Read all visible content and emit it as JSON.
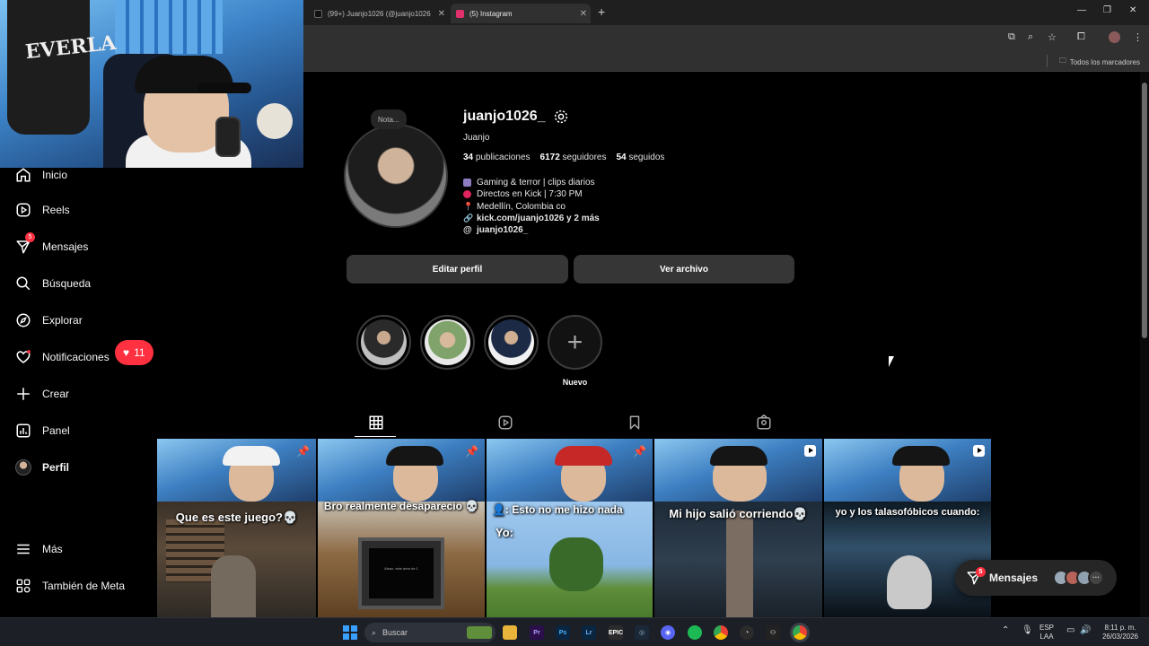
{
  "browser": {
    "tabs": [
      {
        "title": "(99+) Juanjo1026 (@juanjo1026",
        "favicon_color": "#111111"
      },
      {
        "title": "(5) Instagram",
        "favicon_color": "#e1306c"
      }
    ],
    "new_tab_icon": "plus-icon",
    "bookmarks_label": "Todos los marcadores"
  },
  "sidebar": {
    "items": [
      {
        "label": "Inicio",
        "icon": "home-icon"
      },
      {
        "label": "Reels",
        "icon": "reels-icon"
      },
      {
        "label": "Mensajes",
        "icon": "messenger-icon",
        "badge": "5"
      },
      {
        "label": "Búsqueda",
        "icon": "search-icon"
      },
      {
        "label": "Explorar",
        "icon": "compass-icon"
      },
      {
        "label": "Notificaciones",
        "icon": "heart-icon"
      },
      {
        "label": "Crear",
        "icon": "plus-icon"
      },
      {
        "label": "Panel",
        "icon": "chart-icon"
      },
      {
        "label": "Perfil",
        "icon": "avatar"
      }
    ],
    "notifications_count": "11",
    "more_label": "Más",
    "meta_label": "También de Meta"
  },
  "profile": {
    "note_label": "Nota...",
    "username": "juanjo1026_",
    "full_name": "Juanjo",
    "posts_count": "34",
    "posts_label": "publicaciones",
    "followers_count": "6172",
    "followers_label": "seguidores",
    "following_count": "54",
    "following_label": "seguidos",
    "bio": [
      {
        "text": "Gaming & terror | clips diarios",
        "icon": "gamepad-icon",
        "color": "#8e7cc3"
      },
      {
        "text": "Directos en Kick | 7:30 PM",
        "icon": "red-circle-icon",
        "color": "#e0245e"
      },
      {
        "text": "Medellín, Colombia co",
        "icon": "pin-icon",
        "color": "#e0245e"
      }
    ],
    "link": "kick.com/juanjo1026 y 2 más",
    "threads": "juanjo1026_",
    "edit_button": "Editar perfil",
    "archive_button": "Ver archivo"
  },
  "highlights": {
    "new_label": "Nuevo"
  },
  "posts": [
    {
      "caption": "Que es este juego?💀",
      "badge": "pin-icon"
    },
    {
      "caption": "Bro realmente desaparecio 💀",
      "badge": "pin-icon",
      "screen_text": "Aleaz, este área de 1"
    },
    {
      "caption": "👤: Esto no me hizo nada",
      "caption2": "Yo:",
      "badge": "pin-icon"
    },
    {
      "caption": "Mi hijo salió corriendo💀",
      "badge": "reel-icon"
    },
    {
      "caption": "yo y los talasofóbicos cuando:",
      "badge": "reel-icon"
    }
  ],
  "messages_pill": {
    "label": "Mensajes",
    "badge": "5"
  },
  "taskbar": {
    "search_placeholder": "Buscar",
    "lang_line1": "ESP",
    "lang_line2": "LAA",
    "time": "8:11 p. m.",
    "date": "26/03/2026"
  },
  "colors": {
    "accent_red": "#ff3040",
    "button_bg": "#363636",
    "bg": "#000000"
  }
}
